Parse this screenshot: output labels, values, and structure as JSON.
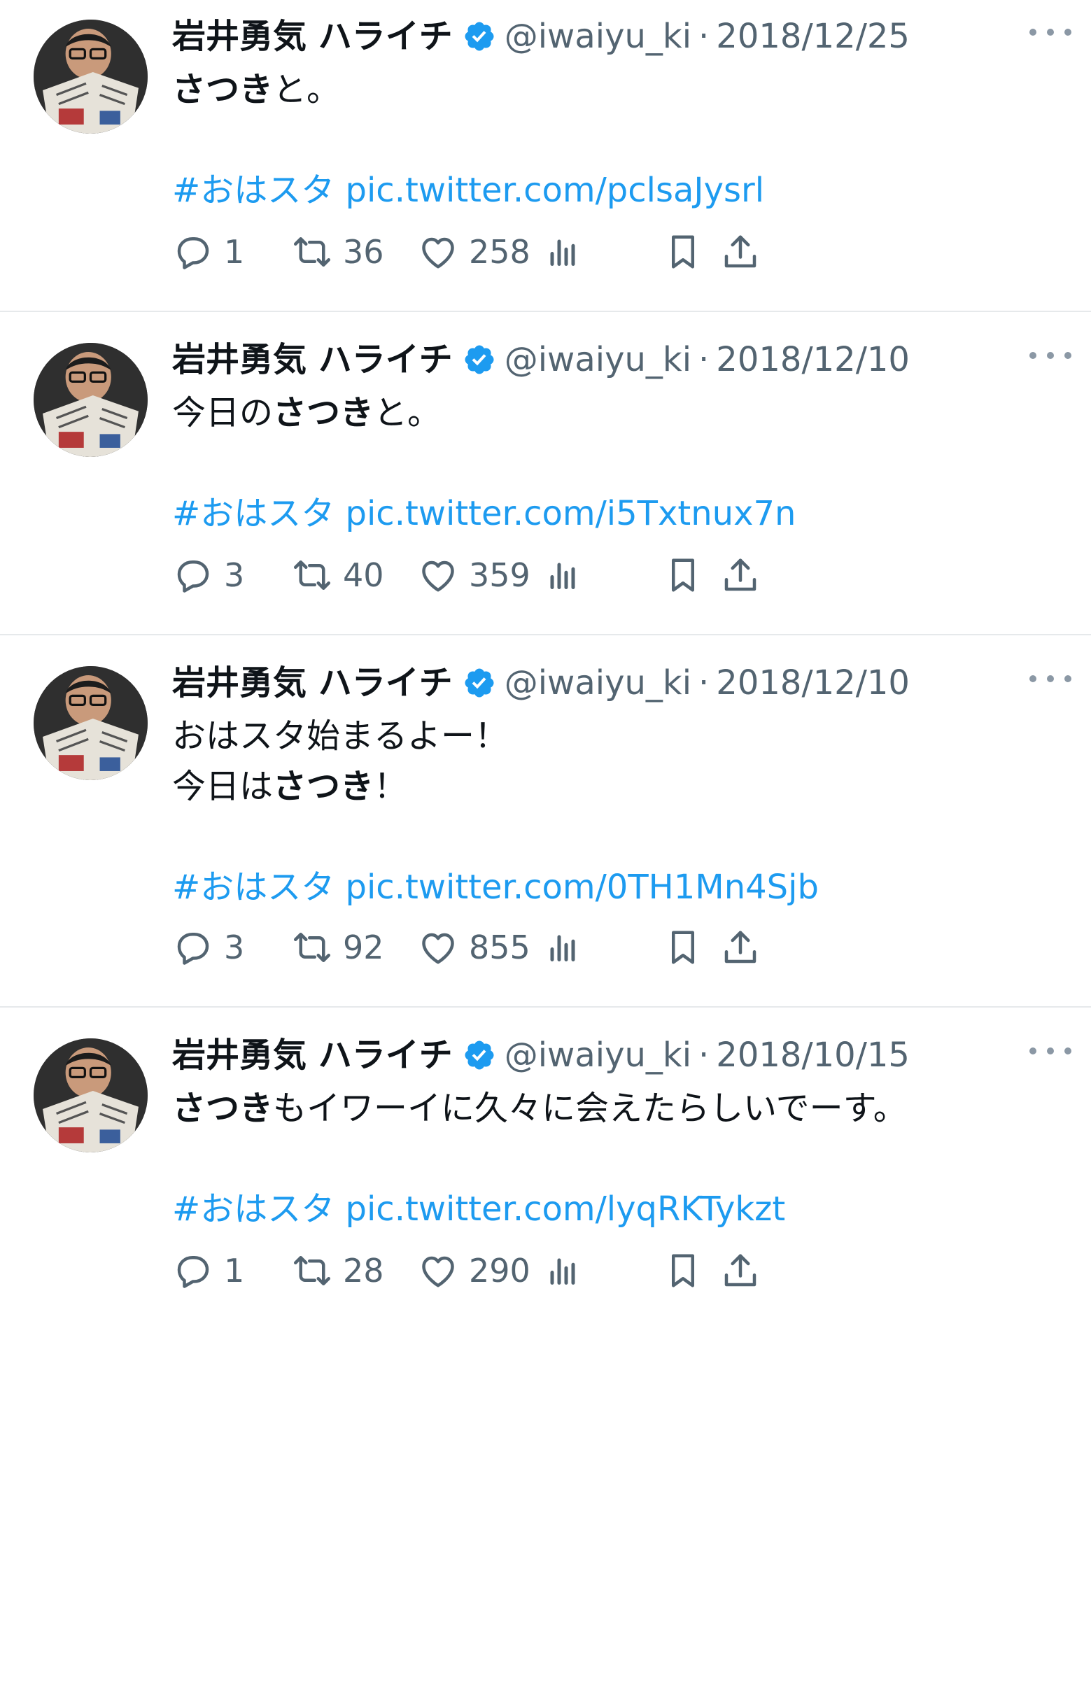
{
  "tweets": [
    {
      "name": "岩井勇気 ハライチ",
      "handle": "@iwaiyu_ki",
      "separator": "·",
      "date": "2018/12/25",
      "body_lines": [
        [
          {
            "t": "さつき",
            "b": true
          },
          {
            "t": "と。"
          }
        ],
        [],
        [
          {
            "t": " #おはスタ",
            "link": true
          },
          {
            "t": " pic.twitter.com/pclsaJysrl",
            "link": true
          }
        ]
      ],
      "replies": "1",
      "retweets": "36",
      "likes": "258"
    },
    {
      "name": "岩井勇気 ハライチ",
      "handle": "@iwaiyu_ki",
      "separator": "·",
      "date": "2018/12/10",
      "body_lines": [
        [
          {
            "t": "今日の"
          },
          {
            "t": "さつき",
            "b": true
          },
          {
            "t": "と。"
          }
        ],
        [],
        [
          {
            "t": "#おはスタ",
            "link": true
          },
          {
            "t": " pic.twitter.com/i5Txtnux7n",
            "link": true
          }
        ]
      ],
      "replies": "3",
      "retweets": "40",
      "likes": "359"
    },
    {
      "name": "岩井勇気 ハライチ",
      "handle": "@iwaiyu_ki",
      "separator": "·",
      "date": "2018/12/10",
      "body_lines": [
        [
          {
            "t": "おはスタ始まるよー！"
          }
        ],
        [
          {
            "t": "今日は"
          },
          {
            "t": "さつき",
            "b": true
          },
          {
            "t": "！"
          }
        ],
        [],
        [
          {
            "t": "#おはスタ",
            "link": true
          },
          {
            "t": " pic.twitter.com/0TH1Mn4Sjb",
            "link": true
          }
        ]
      ],
      "replies": "3",
      "retweets": "92",
      "likes": "855"
    },
    {
      "name": "岩井勇気 ハライチ",
      "handle": "@iwaiyu_ki",
      "separator": "·",
      "date": "2018/10/15",
      "body_lines": [
        [
          {
            "t": "さつき",
            "b": true
          },
          {
            "t": "もイワーイに久々に会えたらしいでーす。"
          }
        ],
        [],
        [
          {
            "t": "#おはスタ",
            "link": true
          },
          {
            "t": " pic.twitter.com/lyqRKTykzt",
            "link": true
          }
        ]
      ],
      "replies": "1",
      "retweets": "28",
      "likes": "290"
    }
  ],
  "icons": {
    "reply": "reply-icon",
    "retweet": "retweet-icon",
    "like": "heart-icon",
    "views": "views-icon",
    "bookmark": "bookmark-icon",
    "share": "share-icon",
    "verified": "verified-badge-icon",
    "more": "more-icon"
  },
  "colors": {
    "link": "#1d9bf0",
    "verified": "#1d9bf0",
    "muted": "#536471",
    "divider": "#e6e9eb"
  }
}
